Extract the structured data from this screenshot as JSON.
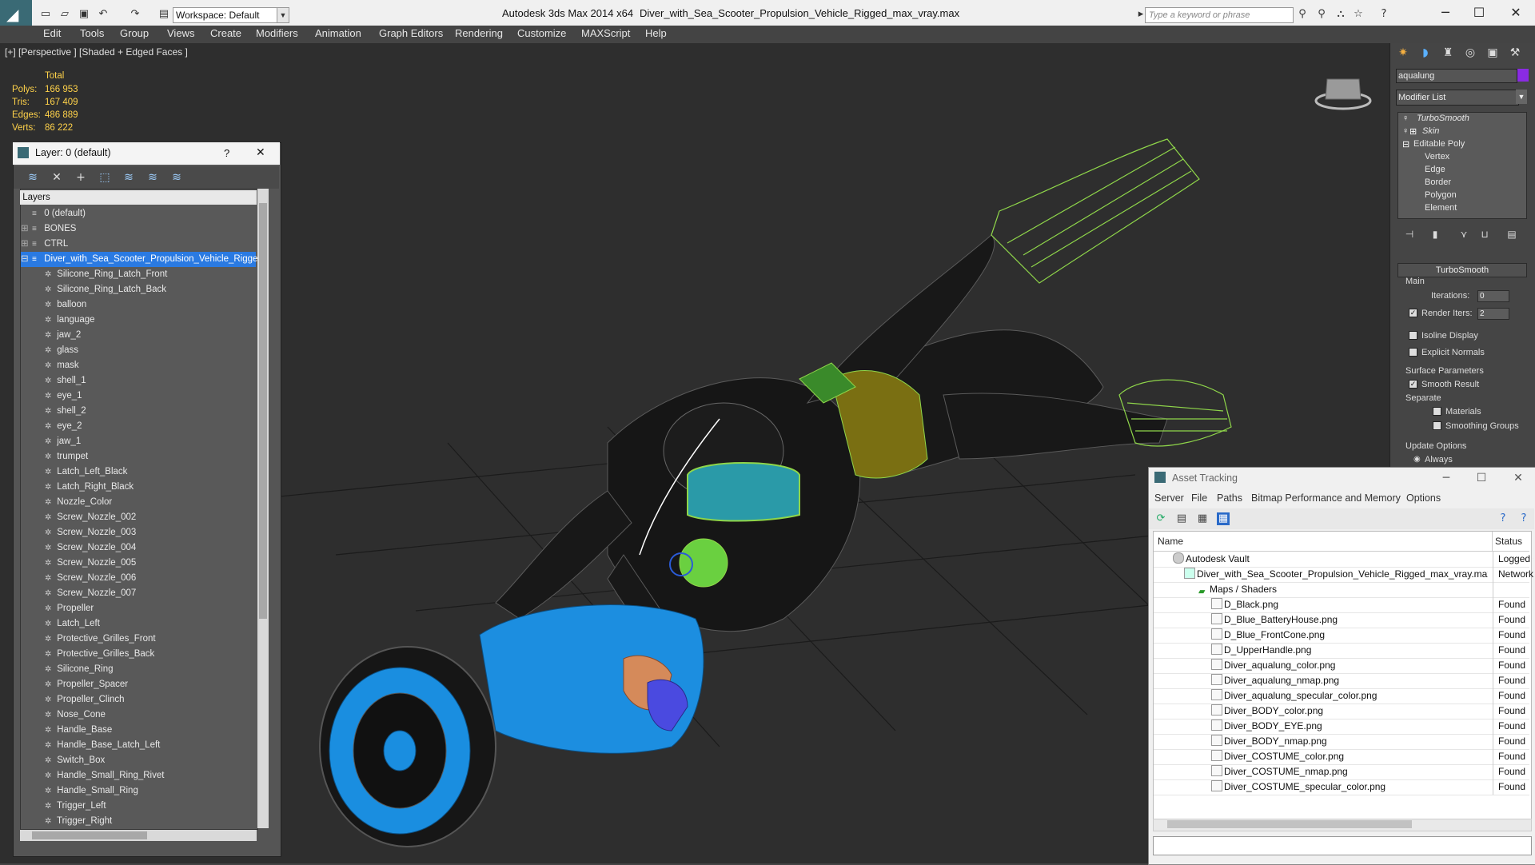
{
  "titlebar": {
    "workspace": "Workspace: Default",
    "app_title": "Autodesk 3ds Max  2014 x64",
    "file_title": "Diver_with_Sea_Scooter_Propulsion_Vehicle_Rigged_max_vray.max",
    "search_placeholder": "Type a keyword or phrase"
  },
  "menu": [
    "Edit",
    "Tools",
    "Group",
    "Views",
    "Create",
    "Modifiers",
    "Animation",
    "Graph Editors",
    "Rendering",
    "Customize",
    "MAXScript",
    "Help"
  ],
  "viewport": {
    "label": "[+] [Perspective ] [Shaded + Edged Faces ]",
    "stats": {
      "header": "Total",
      "rows": [
        {
          "label": "Polys:",
          "value": "166 953"
        },
        {
          "label": "Tris:",
          "value": "167 409"
        },
        {
          "label": "Edges:",
          "value": "486 889"
        },
        {
          "label": "Verts:",
          "value": "86 222"
        }
      ]
    }
  },
  "layer_panel": {
    "title": "Layer: 0 (default)",
    "help": "?",
    "close": "✕",
    "header": "Layers",
    "rows": [
      {
        "label": "0 (default)",
        "level": 1,
        "selected": false
      },
      {
        "label": "BONES",
        "level": 1,
        "selected": false
      },
      {
        "label": "CTRL",
        "level": 1,
        "selected": false
      },
      {
        "label": "Diver_with_Sea_Scooter_Propulsion_Vehicle_Rigged",
        "level": 1,
        "selected": true
      },
      {
        "label": "Silicone_Ring_Latch_Front",
        "level": 2,
        "selected": false
      },
      {
        "label": "Silicone_Ring_Latch_Back",
        "level": 2,
        "selected": false
      },
      {
        "label": "balloon",
        "level": 2,
        "selected": false
      },
      {
        "label": "language",
        "level": 2,
        "selected": false
      },
      {
        "label": "jaw_2",
        "level": 2,
        "selected": false
      },
      {
        "label": "glass",
        "level": 2,
        "selected": false
      },
      {
        "label": "mask",
        "level": 2,
        "selected": false
      },
      {
        "label": "shell_1",
        "level": 2,
        "selected": false
      },
      {
        "label": "eye_1",
        "level": 2,
        "selected": false
      },
      {
        "label": "shell_2",
        "level": 2,
        "selected": false
      },
      {
        "label": "eye_2",
        "level": 2,
        "selected": false
      },
      {
        "label": "jaw_1",
        "level": 2,
        "selected": false
      },
      {
        "label": "trumpet",
        "level": 2,
        "selected": false
      },
      {
        "label": "Latch_Left_Black",
        "level": 2,
        "selected": false
      },
      {
        "label": "Latch_Right_Black",
        "level": 2,
        "selected": false
      },
      {
        "label": "Nozzle_Color",
        "level": 2,
        "selected": false
      },
      {
        "label": "Screw_Nozzle_002",
        "level": 2,
        "selected": false
      },
      {
        "label": "Screw_Nozzle_003",
        "level": 2,
        "selected": false
      },
      {
        "label": "Screw_Nozzle_004",
        "level": 2,
        "selected": false
      },
      {
        "label": "Screw_Nozzle_005",
        "level": 2,
        "selected": false
      },
      {
        "label": "Screw_Nozzle_006",
        "level": 2,
        "selected": false
      },
      {
        "label": "Screw_Nozzle_007",
        "level": 2,
        "selected": false
      },
      {
        "label": "Propeller",
        "level": 2,
        "selected": false
      },
      {
        "label": "Latch_Left",
        "level": 2,
        "selected": false
      },
      {
        "label": "Protective_Grilles_Front",
        "level": 2,
        "selected": false
      },
      {
        "label": "Protective_Grilles_Back",
        "level": 2,
        "selected": false
      },
      {
        "label": "Silicone_Ring",
        "level": 2,
        "selected": false
      },
      {
        "label": "Propeller_Spacer",
        "level": 2,
        "selected": false
      },
      {
        "label": "Propeller_Clinch",
        "level": 2,
        "selected": false
      },
      {
        "label": "Nose_Cone",
        "level": 2,
        "selected": false
      },
      {
        "label": "Handle_Base",
        "level": 2,
        "selected": false
      },
      {
        "label": "Handle_Base_Latch_Left",
        "level": 2,
        "selected": false
      },
      {
        "label": "Switch_Box",
        "level": 2,
        "selected": false
      },
      {
        "label": "Handle_Small_Ring_Rivet",
        "level": 2,
        "selected": false
      },
      {
        "label": "Handle_Small_Ring",
        "level": 2,
        "selected": false
      },
      {
        "label": "Trigger_Left",
        "level": 2,
        "selected": false
      },
      {
        "label": "Trigger_Right",
        "level": 2,
        "selected": false
      }
    ]
  },
  "command_panel": {
    "object_name": "aqualung",
    "object_color": "#8a2be2",
    "modifier_list": "Modifier List",
    "stack": [
      "TurboSmooth",
      "Skin",
      "Editable Poly",
      "Vertex",
      "Edge",
      "Border",
      "Polygon",
      "Element"
    ],
    "rollout_title": "TurboSmooth",
    "main_label": "Main",
    "iterations_label": "Iterations:",
    "iterations_value": "0",
    "render_iters_label": "Render Iters:",
    "render_iters_value": "2",
    "isoline": "Isoline Display",
    "explicit_normals": "Explicit Normals",
    "surface_params": "Surface Parameters",
    "smooth_result": "Smooth Result",
    "separate": "Separate",
    "materials": "Materials",
    "smoothing_groups": "Smoothing Groups",
    "update_options": "Update Options",
    "always": "Always"
  },
  "asset_tracking": {
    "title": "Asset Tracking",
    "menu": [
      "Server",
      "File",
      "Paths",
      "Bitmap Performance and Memory",
      "Options"
    ],
    "col_name": "Name",
    "col_status": "Status",
    "rows": [
      {
        "name": "Autodesk Vault",
        "status": "Logged O",
        "indent": 1
      },
      {
        "name": "Diver_with_Sea_Scooter_Propulsion_Vehicle_Rigged_max_vray.max",
        "status": "Network",
        "indent": 2
      },
      {
        "name": "Maps / Shaders",
        "status": "",
        "indent": 3
      },
      {
        "name": "D_Black.png",
        "status": "Found",
        "indent": 4
      },
      {
        "name": "D_Blue_BatteryHouse.png",
        "status": "Found",
        "indent": 4
      },
      {
        "name": "D_Blue_FrontCone.png",
        "status": "Found",
        "indent": 4
      },
      {
        "name": "D_UpperHandle.png",
        "status": "Found",
        "indent": 4
      },
      {
        "name": "Diver_aqualung_color.png",
        "status": "Found",
        "indent": 4
      },
      {
        "name": "Diver_aqualung_nmap.png",
        "status": "Found",
        "indent": 4
      },
      {
        "name": "Diver_aqualung_specular_color.png",
        "status": "Found",
        "indent": 4
      },
      {
        "name": "Diver_BODY_color.png",
        "status": "Found",
        "indent": 4
      },
      {
        "name": "Diver_BODY_EYE.png",
        "status": "Found",
        "indent": 4
      },
      {
        "name": "Diver_BODY_nmap.png",
        "status": "Found",
        "indent": 4
      },
      {
        "name": "Diver_COSTUME_color.png",
        "status": "Found",
        "indent": 4
      },
      {
        "name": "Diver_COSTUME_nmap.png",
        "status": "Found",
        "indent": 4
      },
      {
        "name": "Diver_COSTUME_specular_color.png",
        "status": "Found",
        "indent": 4
      }
    ]
  }
}
